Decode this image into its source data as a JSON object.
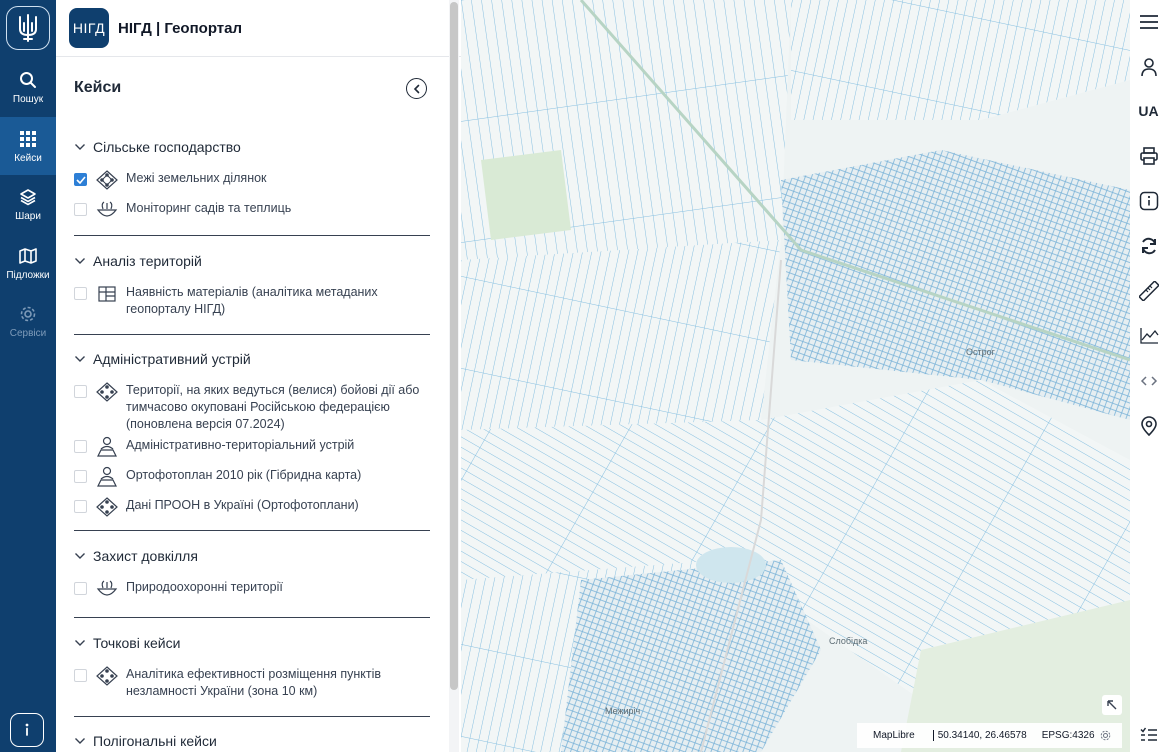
{
  "rail": {
    "items": [
      {
        "label": "Пошук",
        "icon": "search-icon"
      },
      {
        "label": "Кейси",
        "icon": "grid-icon",
        "active": true
      },
      {
        "label": "Шари",
        "icon": "layers-icon"
      },
      {
        "label": "Підложки",
        "icon": "map-icon"
      },
      {
        "label": "Сервіси",
        "icon": "gear-icon",
        "disabled": true
      }
    ]
  },
  "brand": {
    "logo_text": "НІГД",
    "title": "НІГД | Геопортал"
  },
  "panel": {
    "title": "Кейси",
    "sections": [
      {
        "label": "Сільське господарство",
        "items": [
          {
            "label": "Межі земельних ділянок",
            "checked": true,
            "icon": "parcel-network-icon"
          },
          {
            "label": "Моніторинг садів та теплиць",
            "checked": false,
            "icon": "bowl-plant-icon"
          }
        ]
      },
      {
        "label": "Аналіз територій",
        "items": [
          {
            "label": "Наявність матеріалів (аналітика метаданих геопорталу НІГД)",
            "checked": false,
            "icon": "table-icon"
          }
        ]
      },
      {
        "label": "Адміністративний устрій",
        "items": [
          {
            "label": "Території, на яких ведуться (велися) бойові дії або тимчасово окуповані Російською федерацією (поновлена версія 07.2024)",
            "checked": false,
            "icon": "parcel-network-icon"
          },
          {
            "label": "Адміністративно-територіальний устрій",
            "checked": false,
            "icon": "person-map-icon"
          },
          {
            "label": "Ортофотоплан 2010 рік (Гібридна карта)",
            "checked": false,
            "icon": "person-map-icon"
          },
          {
            "label": "Дані ПРООН в Україні (Ортофотоплани)",
            "checked": false,
            "icon": "parcel-network-icon"
          }
        ]
      },
      {
        "label": "Захист довкілля",
        "items": [
          {
            "label": "Природоохоронні території",
            "checked": false,
            "icon": "bowl-plant-icon"
          }
        ]
      },
      {
        "label": "Точкові кейси",
        "items": [
          {
            "label": "Аналітика ефективності розміщення пунктів незламності України (зона 10 км)",
            "checked": false,
            "icon": "parcel-network-icon"
          }
        ]
      },
      {
        "label": "Полігональні кейси",
        "items": []
      }
    ]
  },
  "map": {
    "labels": {
      "town1": "Острог",
      "town2": "Слобідка",
      "town3": "Межиріч"
    },
    "attribution": "MapLibre",
    "coords": "50.34140, 26.46578",
    "crs": "EPSG:4326"
  },
  "toolbar": {
    "items": [
      "menu-icon",
      "user-icon",
      "language",
      "printer-icon",
      "info-icon",
      "refresh-icon",
      "ruler-icon",
      "chart-icon",
      "arrows-icon",
      "location-pin-icon",
      "list-icon"
    ],
    "language": "UA"
  },
  "colors": {
    "rail_bg": "#0f3f6e",
    "rail_active": "#1a5a96",
    "checkbox_checked": "#2d7fd6",
    "parcel_lines": "#7fb8dc"
  }
}
